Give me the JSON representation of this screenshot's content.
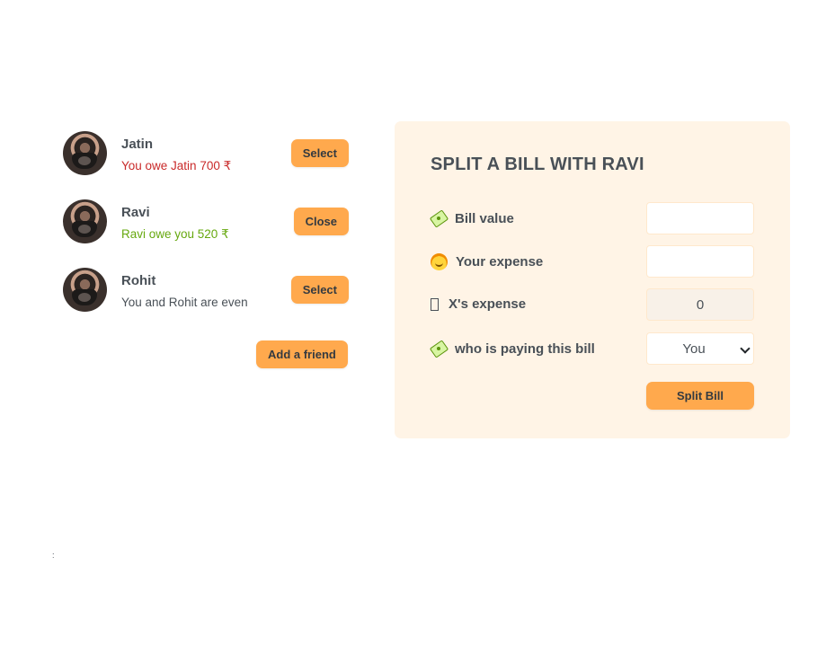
{
  "friends": [
    {
      "name": "Jatin",
      "status": "You owe Jatin 700 ₹",
      "status_type": "red",
      "button": "Select"
    },
    {
      "name": "Ravi",
      "status": "Ravi owe you 520 ₹",
      "status_type": "green",
      "button": "Close"
    },
    {
      "name": "Rohit",
      "status": "You and Rohit are even",
      "status_type": "neutral",
      "button": "Select"
    }
  ],
  "add_friend_label": "Add a friend",
  "split": {
    "title": "SPLIT A BILL WITH RAVI",
    "bill_value_label": "Bill value",
    "bill_value": "",
    "your_expense_label": "Your expense",
    "your_expense": "",
    "friend_expense_label": "X's expense",
    "friend_expense": "0",
    "payer_label": "who is paying this bill",
    "payer_selected": "You",
    "submit_label": "Split Bill"
  },
  "stray_text": ":",
  "colors": {
    "accent": "#ffa94d",
    "panel_bg": "#fff4e6",
    "owe_red": "#c92a2a",
    "owed_green": "#66a80f",
    "text": "#495057"
  }
}
